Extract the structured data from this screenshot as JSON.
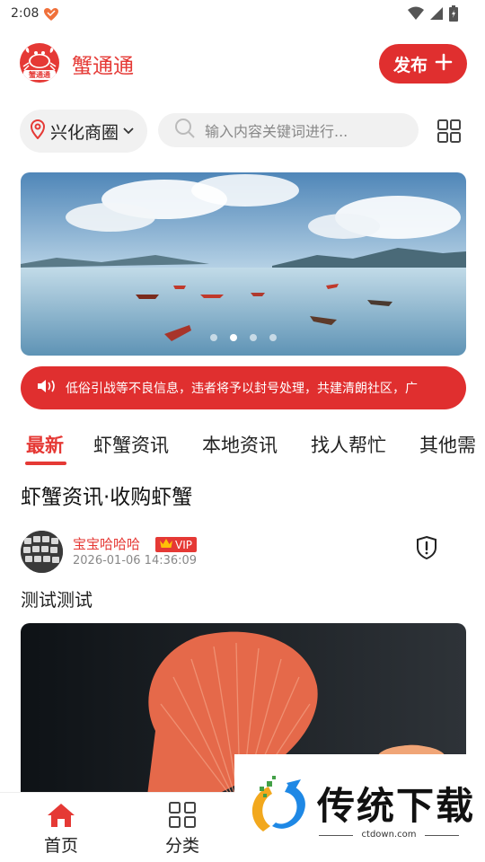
{
  "status_bar": {
    "time": "2:08"
  },
  "header": {
    "app_title": "蟹通通",
    "logo_text": "蟹通通",
    "publish_label": "发布"
  },
  "location": {
    "name": "兴化商圈"
  },
  "search": {
    "placeholder": "输入内容关键词进行..."
  },
  "banner": {
    "slide_count": 4,
    "active_slide_index": 1
  },
  "notice": {
    "text": "低俗引战等不良信息，违者将予以封号处理，共建清朗社区，广"
  },
  "tabs": [
    "最新",
    "虾蟹资讯",
    "本地资讯",
    "找人帮忙",
    "其他需"
  ],
  "active_tab": "最新",
  "section_title": "虾蟹资讯·收购虾蟹",
  "post": {
    "username": "宝宝哈哈哈",
    "badge": "VIP",
    "timestamp": "2026-01-06 14:36:09",
    "text": "测试测试"
  },
  "bottom_nav": [
    {
      "label": "首页",
      "icon": "home-icon",
      "active": true
    },
    {
      "label": "分类",
      "icon": "category-grid-icon",
      "active": false
    }
  ],
  "watermark": {
    "text": "传统下载",
    "url": "ctdown.com"
  },
  "colors": {
    "brand_red": "#e53935",
    "button_red": "#e02f2f",
    "gray_bg": "#f1f1f1"
  }
}
